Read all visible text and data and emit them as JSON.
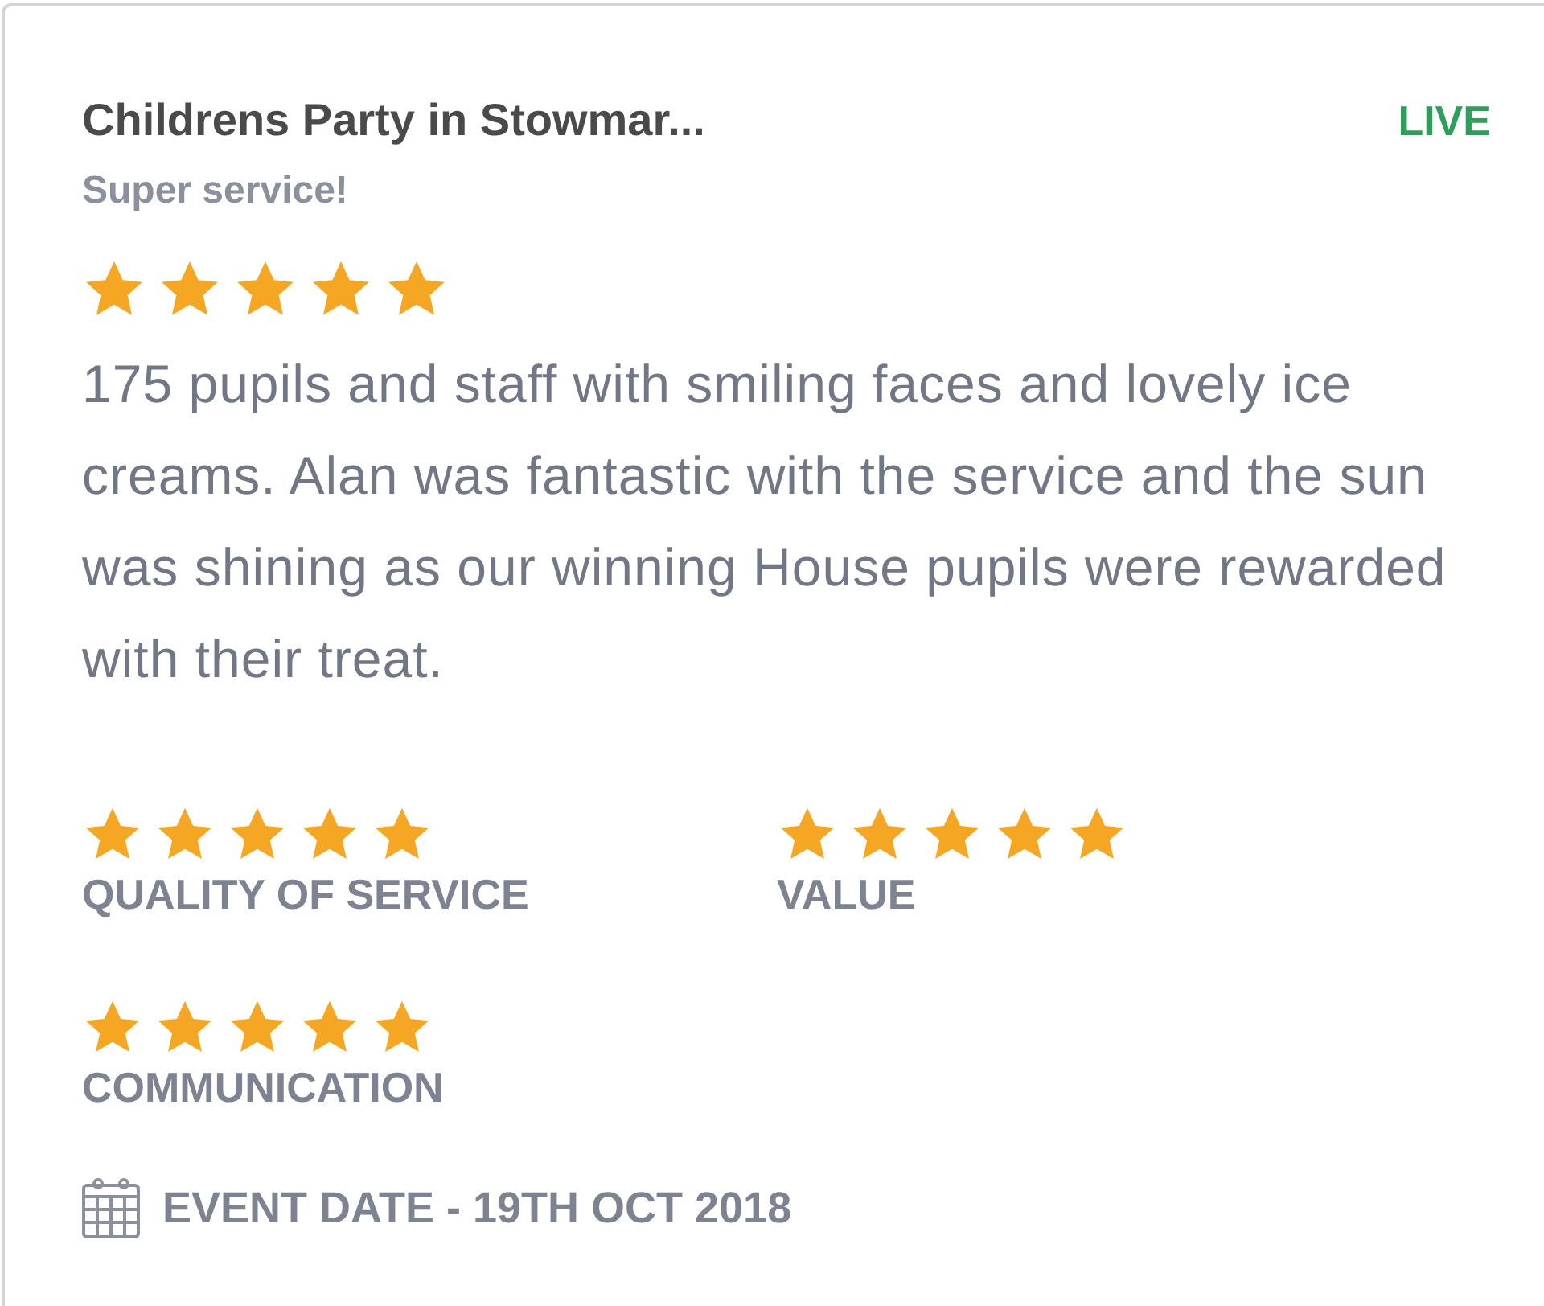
{
  "review": {
    "title": "Childrens Party in Stowmar...",
    "status": "LIVE",
    "headline": "Super service!",
    "stars": 5,
    "body": "175 pupils and staff with smiling faces and lovely ice creams. Alan was fantastic with the service and the sun was shining as our winning House pupils were rewarded with their treat.",
    "ratings": [
      {
        "label": "QUALITY OF SERVICE",
        "stars": 5
      },
      {
        "label": "VALUE",
        "stars": 5
      },
      {
        "label": "COMMUNICATION",
        "stars": 5
      }
    ],
    "event_date": "EVENT DATE - 19TH OCT 2018"
  }
}
